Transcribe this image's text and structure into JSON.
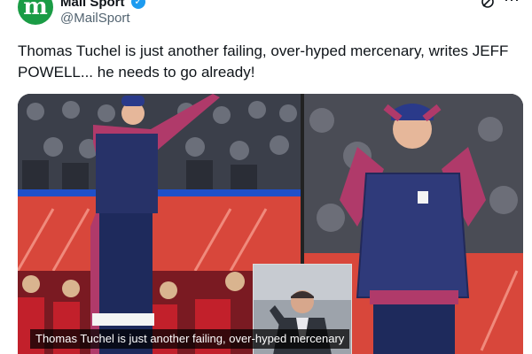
{
  "account": {
    "display_name": "Mail Sport",
    "handle": "@MailSport",
    "avatar_letter": "m",
    "brand_color": "#1a9c45",
    "verified_color": "#1d9bf0"
  },
  "tweet": {
    "text": "Thomas Tuchel is just another failing, over-hyped mercenary, writes JEFF POWELL... he needs to go already!"
  },
  "media": {
    "caption": "Thomas Tuchel is just another failing, over-hyped mercenary",
    "icons": [
      "grok-icon",
      "more-icon",
      "verified-icon"
    ]
  }
}
